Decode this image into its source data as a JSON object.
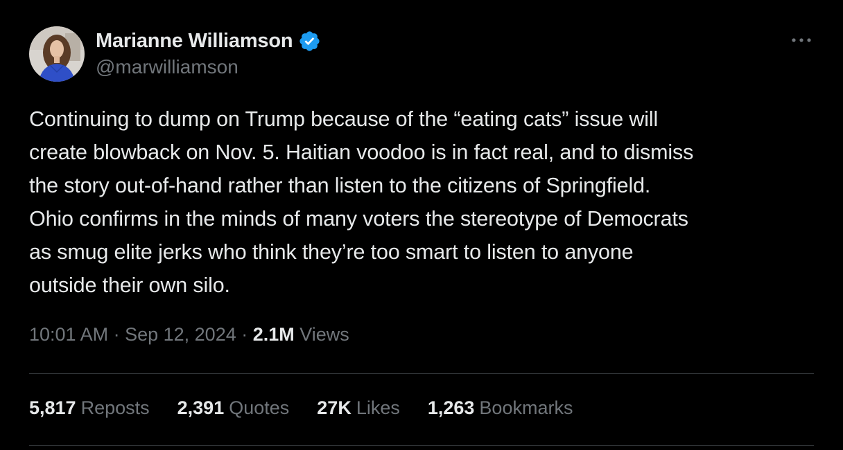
{
  "author": {
    "display_name": "Marianne Williamson",
    "handle": "@marwilliamson",
    "verified_icon": "verified-badge-icon",
    "avatar_icon": "profile-photo"
  },
  "more_icon": "more-horizontal-icon",
  "tweet": {
    "text": "Continuing to dump on Trump because of the “eating cats” issue will\ncreate blowback on Nov. 5. Haitian voodoo is in fact real, and to dismiss\nthe story out-of-hand rather than listen to the citizens of Springfield.\nOhio confirms in the minds of many voters the stereotype of Democrats\nas smug elite jerks who think they’re too smart to listen to anyone\noutside their own silo."
  },
  "meta": {
    "time": "10:01 AM",
    "sep1": " · ",
    "date": "Sep 12, 2024",
    "sep2": " · ",
    "views_count": "2.1M",
    "views_label": " Views"
  },
  "stats": {
    "reposts": {
      "count": "5,817",
      "label": "Reposts"
    },
    "quotes": {
      "count": "2,391",
      "label": "Quotes"
    },
    "likes": {
      "count": "27K",
      "label": "Likes"
    },
    "bookmarks": {
      "count": "1,263",
      "label": "Bookmarks"
    }
  },
  "colors": {
    "background": "#000000",
    "primary_text": "#e7e9ea",
    "secondary_text": "#71767b",
    "divider": "#2f3336",
    "verified_blue": "#1d9bf0"
  }
}
